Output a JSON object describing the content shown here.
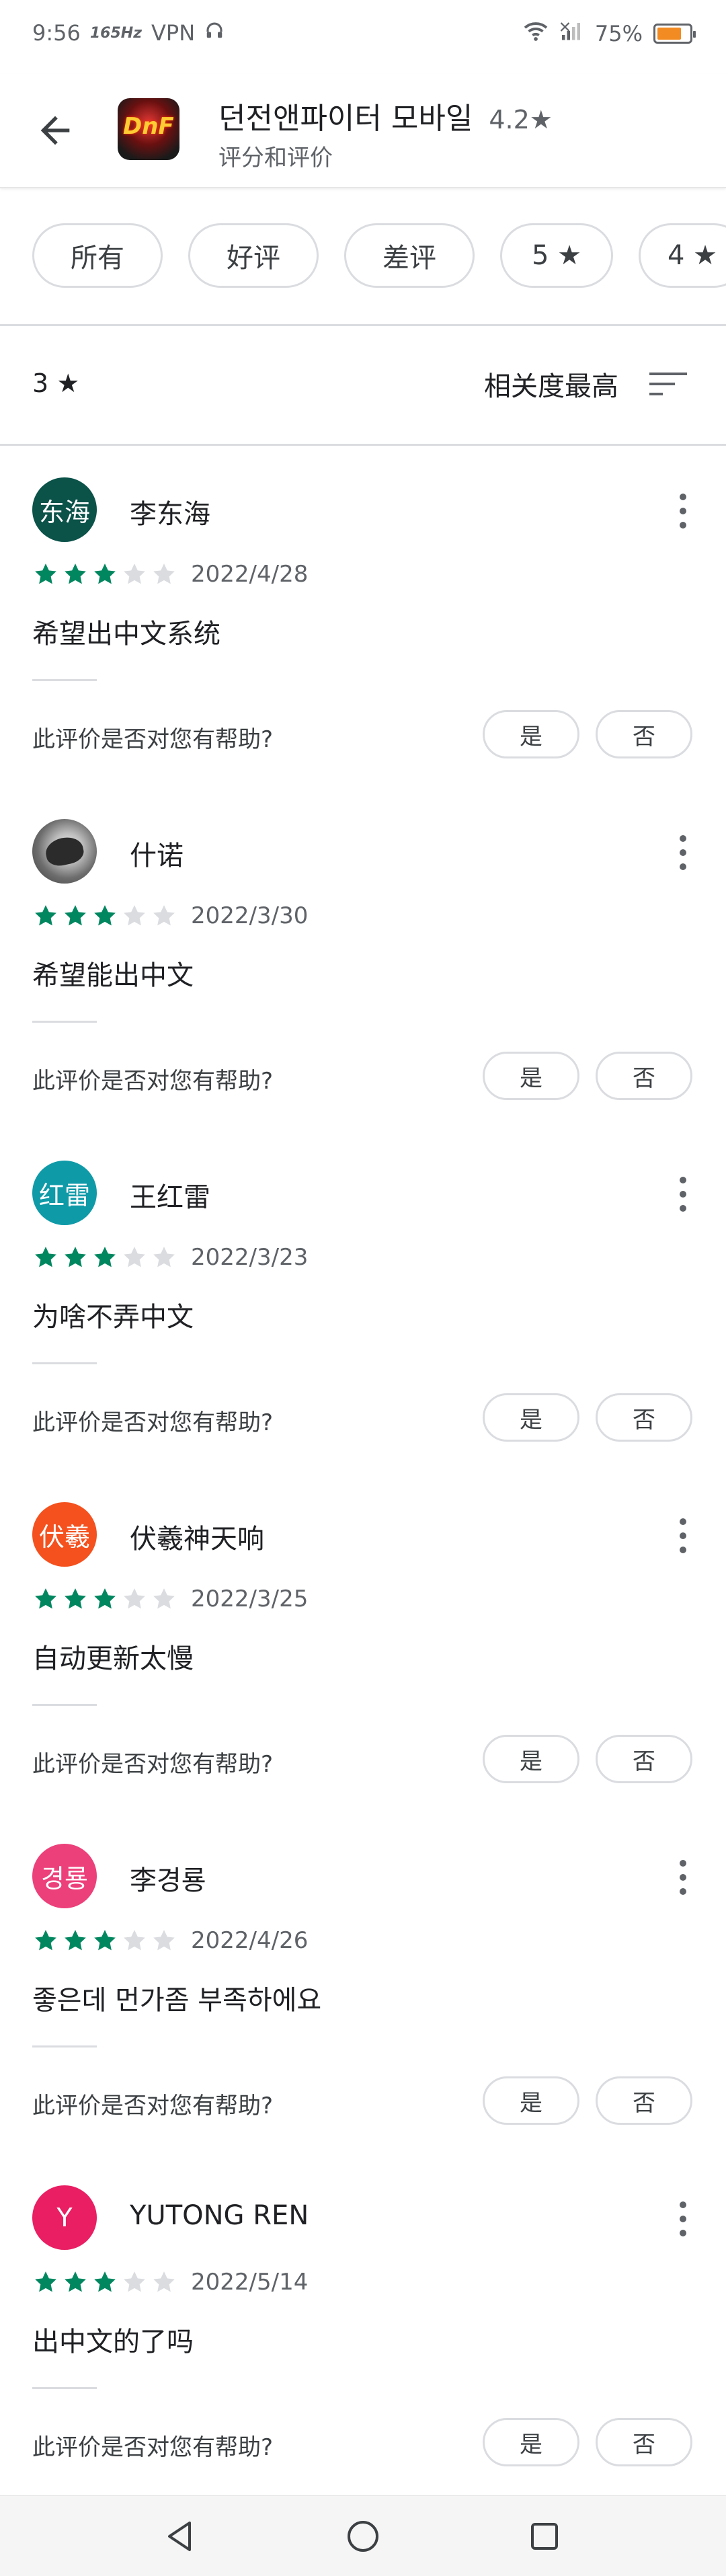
{
  "status_bar": {
    "time": "9:56",
    "network_speed": "165Hz",
    "vpn": "VPN",
    "battery_percent": "75%",
    "battery_level": 0.75
  },
  "header": {
    "app_title": "던전앤파이터 모바일",
    "app_rating": "4.2",
    "subtitle": "评分和评价"
  },
  "filters": {
    "chips": [
      "所有",
      "好评",
      "差评",
      "5",
      "4"
    ]
  },
  "sort": {
    "star_filter": "3",
    "sort_label": "相关度最高"
  },
  "reviews": [
    {
      "avatar_text": "东海",
      "avatar_color": "#0b5249",
      "name": "李东海",
      "stars": 3,
      "date": "2022/4/28",
      "text": "希望出中文系统",
      "helpful_prompt": "此评价是否对您有帮助?",
      "yes": "是",
      "no": "否"
    },
    {
      "avatar_text": "",
      "avatar_color": "#6d6d6d",
      "name": "什诺",
      "stars": 3,
      "date": "2022/3/30",
      "text": "希望能出中文",
      "helpful_prompt": "此评价是否对您有帮助?",
      "yes": "是",
      "no": "否"
    },
    {
      "avatar_text": "红雷",
      "avatar_color": "#0f9aa8",
      "name": "王红雷",
      "stars": 3,
      "date": "2022/3/23",
      "text": "为啥不弄中文",
      "helpful_prompt": "此评价是否对您有帮助?",
      "yes": "是",
      "no": "否"
    },
    {
      "avatar_text": "伏羲",
      "avatar_color": "#f4511e",
      "name": "伏羲神天响",
      "stars": 3,
      "date": "2022/3/25",
      "text": "自动更新太慢",
      "helpful_prompt": "此评价是否对您有帮助?",
      "yes": "是",
      "no": "否"
    },
    {
      "avatar_text": "경룡",
      "avatar_color": "#ec407a",
      "name": "李경룡",
      "stars": 3,
      "date": "2022/4/26",
      "text": "좋은데 먼가좀 부족하에요",
      "helpful_prompt": "此评价是否对您有帮助?",
      "yes": "是",
      "no": "否"
    },
    {
      "avatar_text": "Y",
      "avatar_color": "#e91e63",
      "name": "YUTONG REN",
      "stars": 3,
      "date": "2022/5/14",
      "text": "出中文的了吗",
      "helpful_prompt": "此评价是否对您有帮助?",
      "yes": "是",
      "no": "否"
    }
  ],
  "colors": {
    "star_filled": "#01875f",
    "star_empty": "#dadce0"
  }
}
